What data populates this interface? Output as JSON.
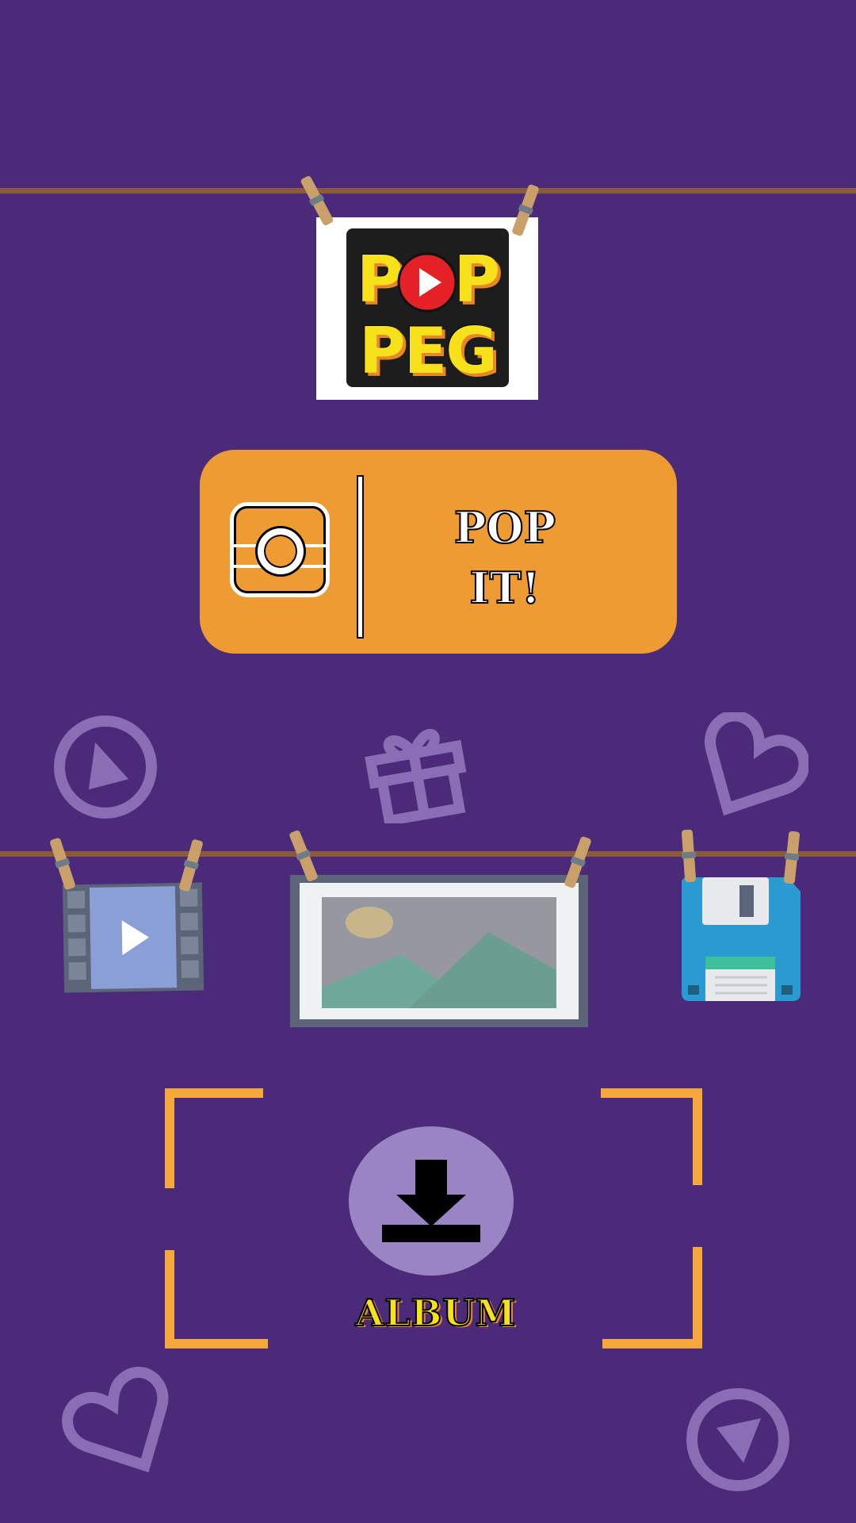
{
  "logo": {
    "line1": "POP",
    "line2": "PEG"
  },
  "pop_button": {
    "label_line1": "POP",
    "label_line2": "IT!"
  },
  "album": {
    "label": "ALBUM"
  },
  "icons": {
    "top_left": "play-circle-icon",
    "top_center": "gift-icon",
    "top_right": "heart-icon",
    "card_left": "video-icon",
    "card_center": "picture-icon",
    "card_right": "save-icon",
    "album": "download-icon",
    "bottom_left": "heart-icon",
    "bottom_right": "play-circle-icon"
  },
  "colors": {
    "background": "#4b2a7a",
    "accent_orange": "#ee9b33",
    "rope": "#8a5a3a",
    "deco_lilac": "#8a6db5",
    "logo_yellow": "#f6e11a"
  }
}
